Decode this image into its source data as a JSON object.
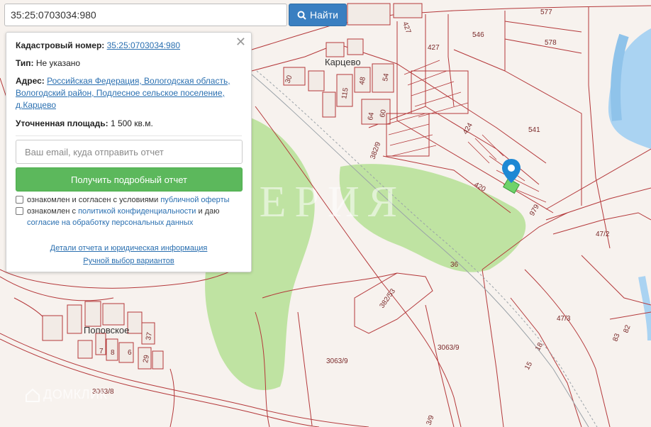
{
  "search": {
    "value": "35:25:0703034:980",
    "button_label": "Найти"
  },
  "panel": {
    "cadastral_label": "Кадастровый номер:",
    "cadastral_value": "35:25:0703034:980",
    "type_label": "Тип:",
    "type_value": "Не указано",
    "address_label": "Адрес:",
    "address_line1": "Российская Федерация, Вологодская область,",
    "address_line2": "Вологодский район, Подлесное сельское поселение,",
    "address_line3": "д.Карцево",
    "area_label": "Уточненная площадь:",
    "area_value": "1 500 кв.м.",
    "email_placeholder": "Ваш email, куда отправить отчет",
    "report_button": "Получить подробный отчет",
    "consent1_text": "ознакомлен и согласен с условиями",
    "consent1_link": "публичной оферты",
    "consent2_text_a": "ознакомлен с",
    "consent2_link_a": "политикой конфиденциальности",
    "consent2_text_b": "и даю",
    "consent2_link_b": "согласие на обработку персональных данных",
    "details_link": "Детали отчета и юридическая информация",
    "manual_link": "Ручной выбор вариантов"
  },
  "map": {
    "labels": {
      "village_kartsevo": "Карцево",
      "village_popovskoe": "Поповское",
      "p577": "577",
      "p546": "546",
      "p427a": "427",
      "p427b": "427",
      "p578": "578",
      "p541": "541",
      "p424": "424",
      "p420": "420",
      "p979": "979",
      "p3829": "382/9",
      "p472": "47/2",
      "p473": "47/3",
      "p36": "36",
      "p38253": "382/53",
      "p30639a": "3063/9",
      "p30639b": "3063/9",
      "p30638": "3063/8",
      "p18": "18",
      "p15": "15",
      "p83": "83",
      "p82": "82",
      "p39": "3/9",
      "p30": "30",
      "p115": "115",
      "p48": "48",
      "p54": "54",
      "p64": "64",
      "p60": "60",
      "p37": "37",
      "p29": "29",
      "p7": "7",
      "p8": "8",
      "p6": "6"
    },
    "watermark": "ИМПЕРИЯ",
    "logo_text": "ДОМКЛИК",
    "colors": {
      "boundary": "#b4383a",
      "forest": "#bfe3a2",
      "water": "#aad3f2",
      "marker": "#1e88d4"
    }
  }
}
